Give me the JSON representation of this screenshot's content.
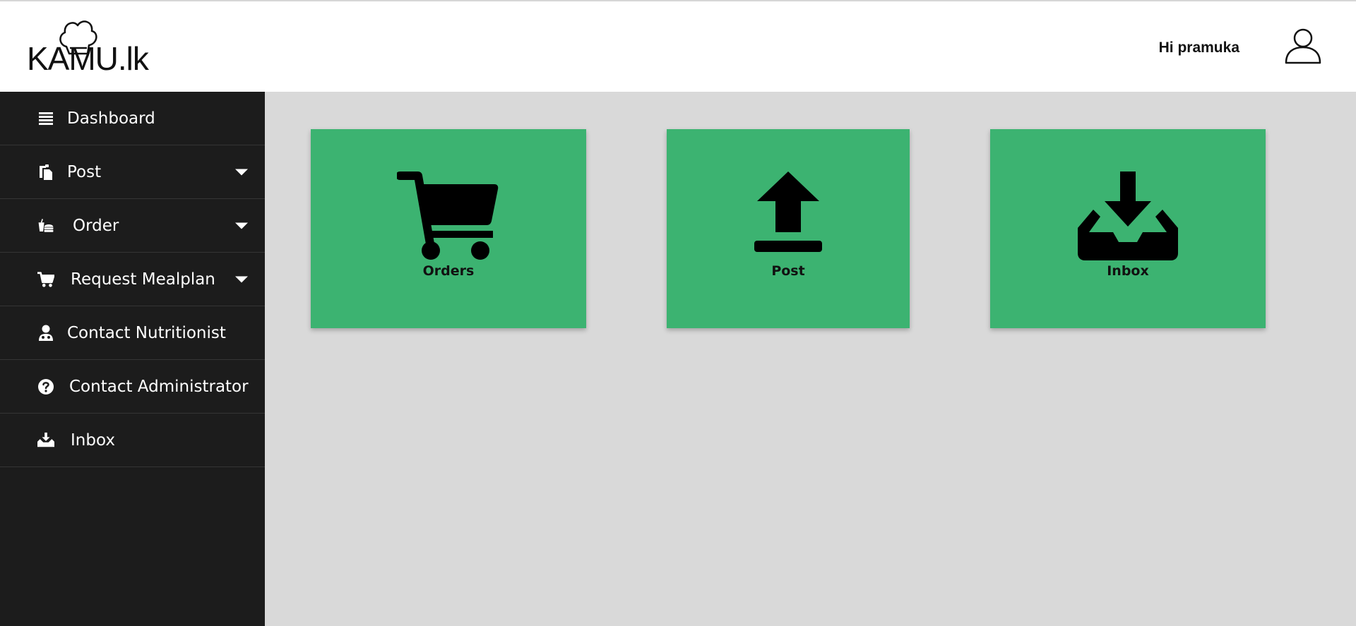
{
  "header": {
    "logo_text": "KAMU.lk",
    "greeting": "Hi pramuka"
  },
  "sidebar": {
    "items": [
      {
        "label": "Dashboard",
        "icon": "list-icon",
        "has_dropdown": false
      },
      {
        "label": "Post",
        "icon": "copy-icon",
        "has_dropdown": true
      },
      {
        "label": "Order",
        "icon": "fastfood-icon",
        "has_dropdown": true
      },
      {
        "label": "Request Mealplan",
        "icon": "cart-icon",
        "has_dropdown": true
      },
      {
        "label": "Contact Nutritionist",
        "icon": "user-doctor-icon",
        "has_dropdown": false
      },
      {
        "label": "Contact Administrator",
        "icon": "question-circle-icon",
        "has_dropdown": false
      },
      {
        "label": "Inbox",
        "icon": "inbox-download-icon",
        "has_dropdown": false
      }
    ]
  },
  "tiles": [
    {
      "label": "Orders",
      "icon": "cart-icon"
    },
    {
      "label": "Post",
      "icon": "upload-icon"
    },
    {
      "label": "Inbox",
      "icon": "inbox-download-icon"
    }
  ],
  "colors": {
    "tile_green": "#3cb371",
    "sidebar_bg": "#1c1c1c",
    "content_bg": "#d9d9d9"
  }
}
